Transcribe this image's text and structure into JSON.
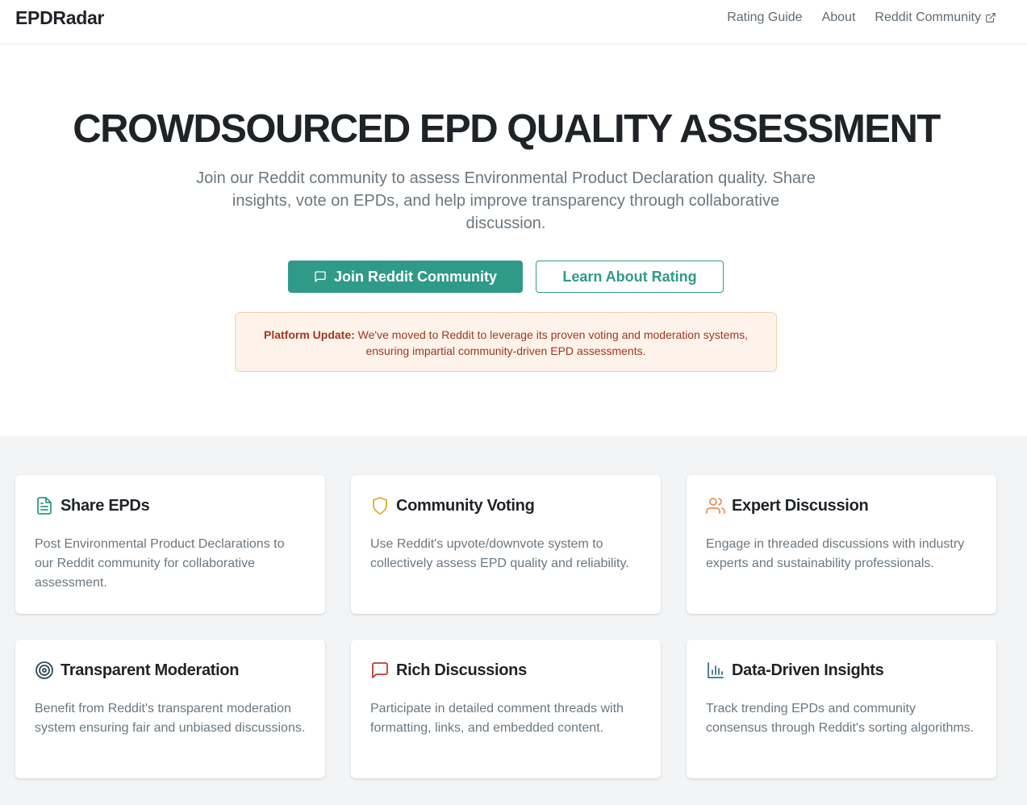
{
  "nav": {
    "brand": "EPDRadar",
    "links": [
      {
        "label": "Rating Guide"
      },
      {
        "label": "About"
      },
      {
        "label": "Reddit Community"
      }
    ]
  },
  "hero": {
    "title": "CROWDSOURCED EPD QUALITY ASSESSMENT",
    "subtitle": "Join our Reddit community to assess Environmental Product Declaration quality. Share insights, vote on EPDs, and help improve transparency through collaborative discussion.",
    "primary_button": "Join Reddit Community",
    "secondary_button": "Learn About Rating",
    "notice_label": "Platform Update:",
    "notice_text": " We've moved to Reddit to leverage its proven voting and moderation systems, ensuring impartial community-driven EPD assessments."
  },
  "features": [
    {
      "title": "Share EPDs",
      "description": "Post Environmental Product Declarations to our Reddit community for collaborative assessment.",
      "icon": "document-icon",
      "color": "#2f9a88"
    },
    {
      "title": "Community Voting",
      "description": "Use Reddit's upvote/downvote system to collectively assess EPD quality and reliability.",
      "icon": "shield-icon",
      "color": "#e2a93b"
    },
    {
      "title": "Expert Discussion",
      "description": "Engage in threaded discussions with industry experts and sustainability professionals.",
      "icon": "users-icon",
      "color": "#e8915a"
    },
    {
      "title": "Transparent Moderation",
      "description": "Benefit from Reddit's transparent moderation system ensuring fair and unbiased discussions.",
      "icon": "target-icon",
      "color": "#2f4a57"
    },
    {
      "title": "Rich Discussions",
      "description": "Participate in detailed comment threads with formatting, links, and embedded content.",
      "icon": "message-icon",
      "color": "#c0392b"
    },
    {
      "title": "Data-Driven Insights",
      "description": "Track trending EPDs and community consensus through Reddit's sorting algorithms.",
      "icon": "bar-chart-icon",
      "color": "#3e6f86"
    }
  ]
}
